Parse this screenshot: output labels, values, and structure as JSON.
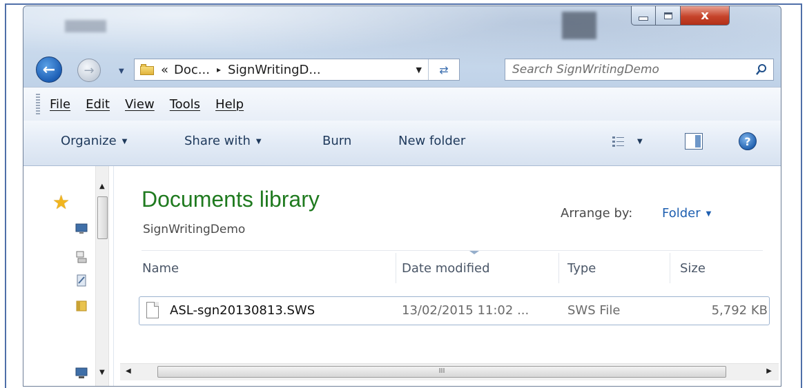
{
  "window": {
    "caption": {
      "minimize": "",
      "maximize": "",
      "close": "x"
    }
  },
  "address": {
    "overflow": "«",
    "crumb1": "Doc...",
    "crumb2": "SignWritingD...",
    "separator": "▸"
  },
  "search": {
    "placeholder": "Search SignWritingDemo"
  },
  "menu": [
    "File",
    "Edit",
    "View",
    "Tools",
    "Help"
  ],
  "commands": {
    "organize": "Organize",
    "share": "Share with",
    "burn": "Burn",
    "new_folder": "New folder"
  },
  "library": {
    "title": "Documents library",
    "subtitle": "SignWritingDemo",
    "arrange_label": "Arrange by:",
    "arrange_value": "Folder"
  },
  "columns": [
    "Name",
    "Date modified",
    "Type",
    "Size"
  ],
  "files": [
    {
      "name": "ASL-sgn20130813.SWS",
      "date": "13/02/2015 11:02 ...",
      "type": "SWS File",
      "size": "5,792 KB"
    }
  ],
  "icons": {
    "back": "back-arrow-icon",
    "forward": "forward-arrow-icon",
    "refresh": "refresh-icon",
    "search": "search-icon",
    "help": "help-icon",
    "favorites": "star-icon"
  },
  "colors": {
    "title_green": "#1f7a1f",
    "link_blue": "#1e5fb0",
    "close_red": "#c6442b"
  }
}
